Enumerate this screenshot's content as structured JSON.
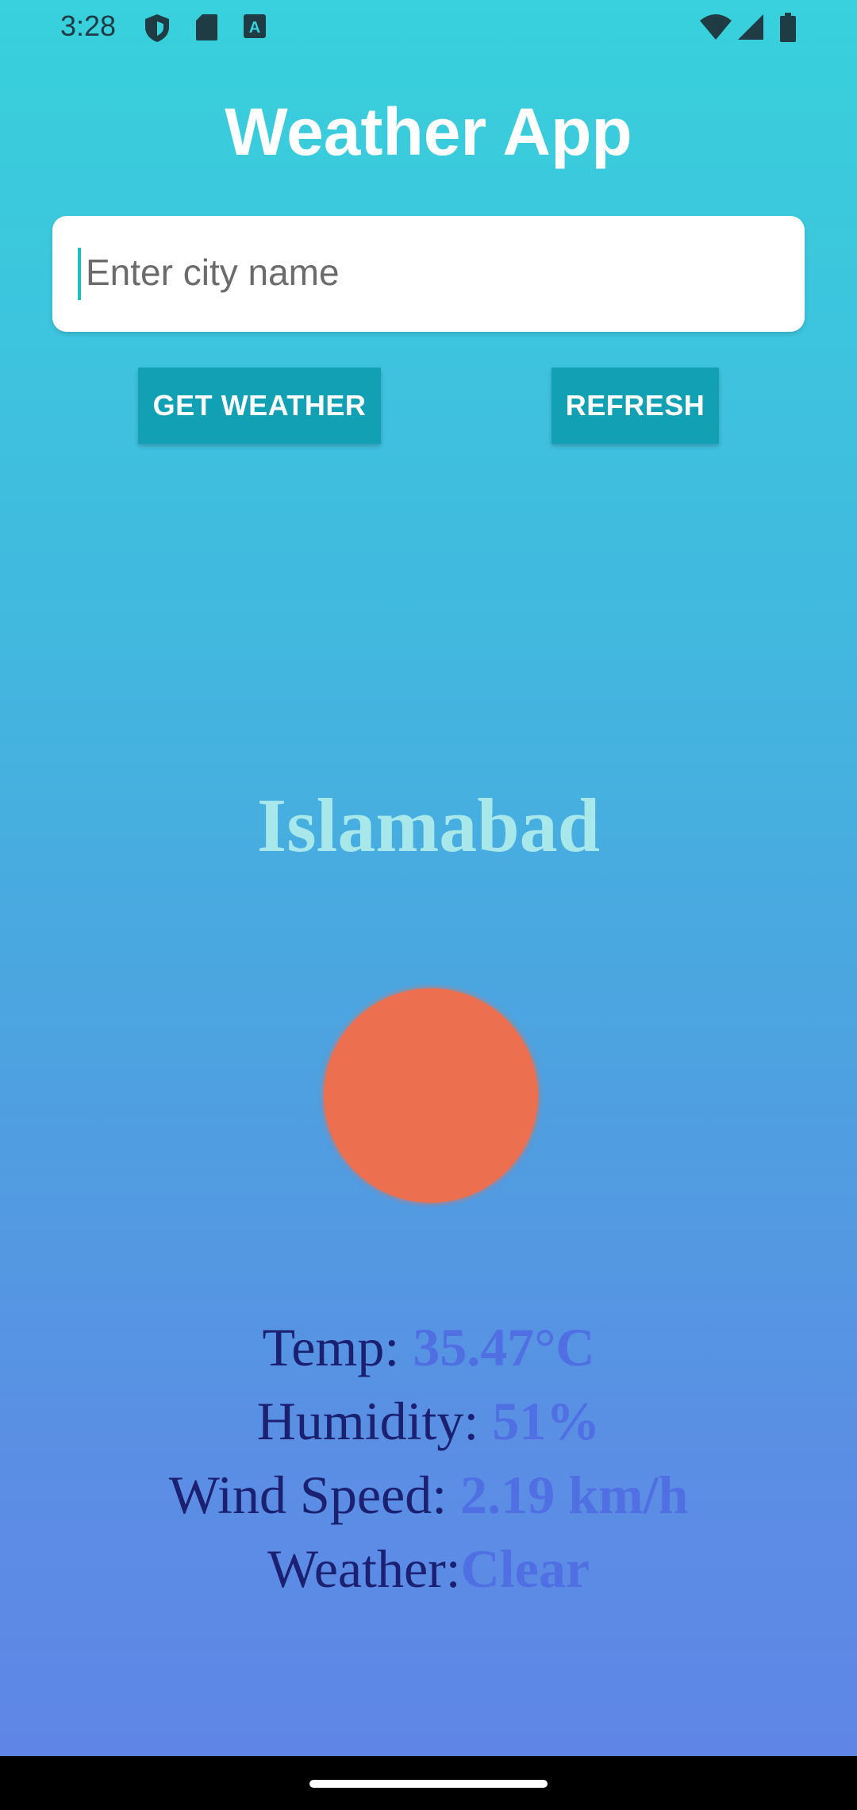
{
  "status_bar": {
    "time": "3:28",
    "icons": [
      "shield-icon",
      "sd-card-icon",
      "a-icon"
    ],
    "right_icons": [
      "wifi-icon",
      "cell-signal-icon",
      "battery-icon"
    ]
  },
  "app": {
    "title": "Weather App"
  },
  "search": {
    "placeholder": "Enter city name",
    "value": ""
  },
  "buttons": {
    "get_weather": "GET WEATHER",
    "refresh": "REFRESH"
  },
  "weather": {
    "city": "Islamabad",
    "icon": "sun-icon",
    "temp_label": "Temp: ",
    "temp_value": "35.47°C",
    "humidity_label": "Humidity: ",
    "humidity_value": "51%",
    "wind_label": "Wind Speed: ",
    "wind_value": "2.19 km/h",
    "condition_label": "Weather:",
    "condition_value": "Clear"
  },
  "colors": {
    "accent": "#12a1b4",
    "sun": "#ec7050",
    "value": "#4f6fe3",
    "label": "#1b2170",
    "city": "#a8e8ea"
  }
}
